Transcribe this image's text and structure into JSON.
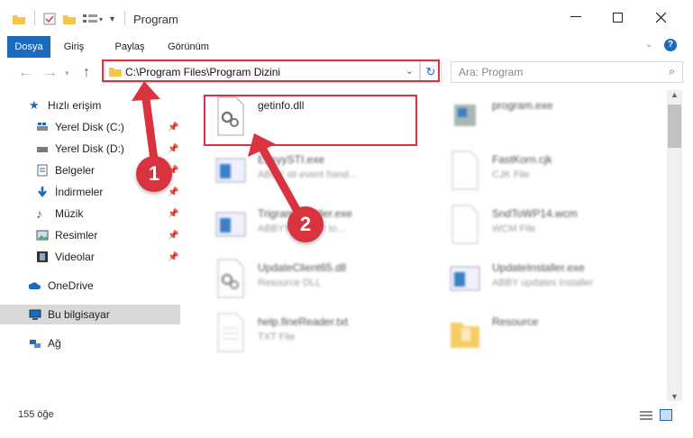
{
  "window": {
    "title": "Program"
  },
  "ribbon": {
    "tabs": [
      "Dosya",
      "Giriş",
      "Paylaş",
      "Görünüm"
    ]
  },
  "address": {
    "path": "C:\\Program Files\\Program Dizini"
  },
  "search": {
    "placeholder": "Ara: Program"
  },
  "sidebar": {
    "items": [
      {
        "label": "Hızlı erişim"
      },
      {
        "label": "Yerel Disk (C:)"
      },
      {
        "label": "Yerel Disk (D:)"
      },
      {
        "label": "Belgeler"
      },
      {
        "label": "İndirmeler"
      },
      {
        "label": "Müzik"
      },
      {
        "label": "Resimler"
      },
      {
        "label": "Videolar"
      },
      {
        "label": "OneDrive"
      },
      {
        "label": "Bu bilgisayar"
      },
      {
        "label": "Ağ"
      }
    ]
  },
  "files": [
    {
      "name": "getinfo.dll",
      "desc": ""
    },
    {
      "name": "program.exe",
      "desc": ""
    },
    {
      "name": "EasyySTI.exe",
      "desc": "ABBY sti event hand..."
    },
    {
      "name": "FastKorn.cjk",
      "desc": "CJK File"
    },
    {
      "name": "TrigramInstaller.exe",
      "desc": "ABBYY Reader to..."
    },
    {
      "name": "SndToWP14.wcm",
      "desc": "WCM File"
    },
    {
      "name": "UpdateClient65.dll",
      "desc": "Resource DLL"
    },
    {
      "name": "UpdateInstaller.exe",
      "desc": "ABBY updates installer"
    },
    {
      "name": "help.fineReader.txt",
      "desc": "TXT File"
    },
    {
      "name": "Resource",
      "desc": ""
    }
  ],
  "status": {
    "count": "155 öğe"
  },
  "annotations": {
    "step1": "1",
    "step2": "2"
  },
  "colors": {
    "accent": "#1a6bbd",
    "highlight": "#d9333f"
  }
}
